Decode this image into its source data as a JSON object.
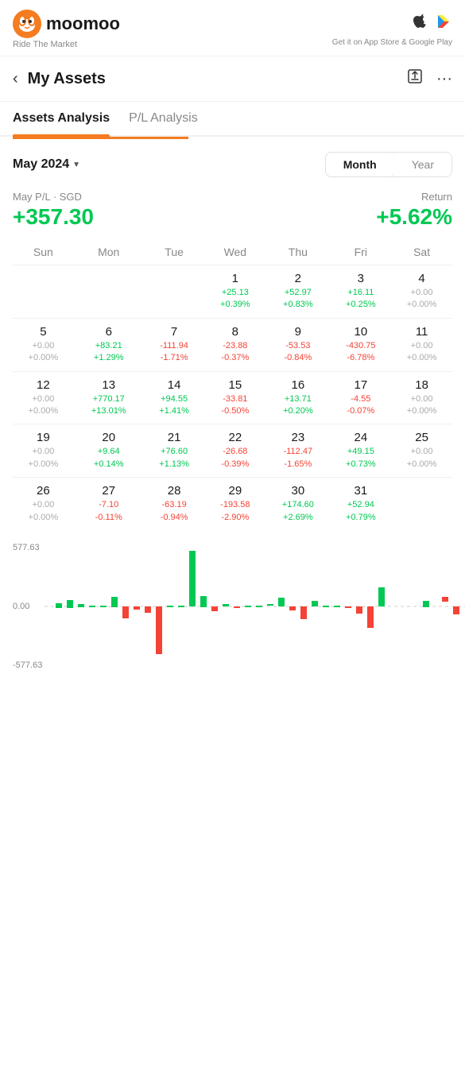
{
  "topbar": {
    "logo_text": "moomoo",
    "tagline": "Ride The Market",
    "store_text": "Get it on App Store & Google Play"
  },
  "nav": {
    "title": "My Assets",
    "back_label": "‹",
    "export_icon": "⬡",
    "more_icon": "···"
  },
  "tabs": [
    {
      "id": "assets",
      "label": "Assets Analysis",
      "active": true
    },
    {
      "id": "pl",
      "label": "P/L Analysis",
      "active": false
    }
  ],
  "period": {
    "month_label": "May 2024",
    "toggle_month": "Month",
    "toggle_year": "Year"
  },
  "pl_summary": {
    "label": "May P/L · SGD",
    "value": "+357.30",
    "return_label": "Return",
    "return_value": "+5.62%"
  },
  "calendar": {
    "headers": [
      "Sun",
      "Mon",
      "Tue",
      "Wed",
      "Thu",
      "Fri",
      "Sat"
    ],
    "weeks": [
      [
        {
          "day": "",
          "pnl": "",
          "pct": ""
        },
        {
          "day": "",
          "pnl": "",
          "pct": ""
        },
        {
          "day": "",
          "pnl": "",
          "pct": ""
        },
        {
          "day": "1",
          "pnl": "+25.13",
          "pct": "+0.39%",
          "color": "green"
        },
        {
          "day": "2",
          "pnl": "+52.97",
          "pct": "+0.83%",
          "color": "green"
        },
        {
          "day": "3",
          "pnl": "+16.11",
          "pct": "+0.25%",
          "color": "green"
        },
        {
          "day": "4",
          "pnl": "+0.00",
          "pct": "+0.00%",
          "color": "gray"
        }
      ],
      [
        {
          "day": "5",
          "pnl": "+0.00",
          "pct": "+0.00%",
          "color": "gray"
        },
        {
          "day": "6",
          "pnl": "+83.21",
          "pct": "+1.29%",
          "color": "green"
        },
        {
          "day": "7",
          "pnl": "-111.94",
          "pct": "-1.71%",
          "color": "red"
        },
        {
          "day": "8",
          "pnl": "-23.88",
          "pct": "-0.37%",
          "color": "red"
        },
        {
          "day": "9",
          "pnl": "-53.53",
          "pct": "-0.84%",
          "color": "red"
        },
        {
          "day": "10",
          "pnl": "-430.75",
          "pct": "-6.78%",
          "color": "red"
        },
        {
          "day": "11",
          "pnl": "+0.00",
          "pct": "+0.00%",
          "color": "gray"
        }
      ],
      [
        {
          "day": "12",
          "pnl": "+0.00",
          "pct": "+0.00%",
          "color": "gray"
        },
        {
          "day": "13",
          "pnl": "+770.17",
          "pct": "+13.01%",
          "color": "green"
        },
        {
          "day": "14",
          "pnl": "+94.55",
          "pct": "+1.41%",
          "color": "green"
        },
        {
          "day": "15",
          "pnl": "-33.81",
          "pct": "-0.50%",
          "color": "red"
        },
        {
          "day": "16",
          "pnl": "+13.71",
          "pct": "+0.20%",
          "color": "green"
        },
        {
          "day": "17",
          "pnl": "-4.55",
          "pct": "-0.07%",
          "color": "red"
        },
        {
          "day": "18",
          "pnl": "+0.00",
          "pct": "+0.00%",
          "color": "gray"
        }
      ],
      [
        {
          "day": "19",
          "pnl": "+0.00",
          "pct": "+0.00%",
          "color": "gray"
        },
        {
          "day": "20",
          "pnl": "+9.64",
          "pct": "+0.14%",
          "color": "green"
        },
        {
          "day": "21",
          "pnl": "+76.60",
          "pct": "+1.13%",
          "color": "green"
        },
        {
          "day": "22",
          "pnl": "-26.68",
          "pct": "-0.39%",
          "color": "red"
        },
        {
          "day": "23",
          "pnl": "-112.47",
          "pct": "-1.65%",
          "color": "red"
        },
        {
          "day": "24",
          "pnl": "+49.15",
          "pct": "+0.73%",
          "color": "green"
        },
        {
          "day": "25",
          "pnl": "+0.00",
          "pct": "+0.00%",
          "color": "gray"
        }
      ],
      [
        {
          "day": "26",
          "pnl": "+0.00",
          "pct": "+0.00%",
          "color": "gray"
        },
        {
          "day": "27",
          "pnl": "-7.10",
          "pct": "-0.11%",
          "color": "red"
        },
        {
          "day": "28",
          "pnl": "-63.19",
          "pct": "-0.94%",
          "color": "red"
        },
        {
          "day": "29",
          "pnl": "-193.58",
          "pct": "-2.90%",
          "color": "red"
        },
        {
          "day": "30",
          "pnl": "+174.60",
          "pct": "+2.69%",
          "color": "green"
        },
        {
          "day": "31",
          "pnl": "+52.94",
          "pct": "+0.79%",
          "color": "green"
        },
        {
          "day": "",
          "pnl": "",
          "pct": ""
        }
      ]
    ]
  },
  "chart": {
    "top_label": "577.63",
    "mid_label": "0.00",
    "bottom_label": "-577.63"
  }
}
